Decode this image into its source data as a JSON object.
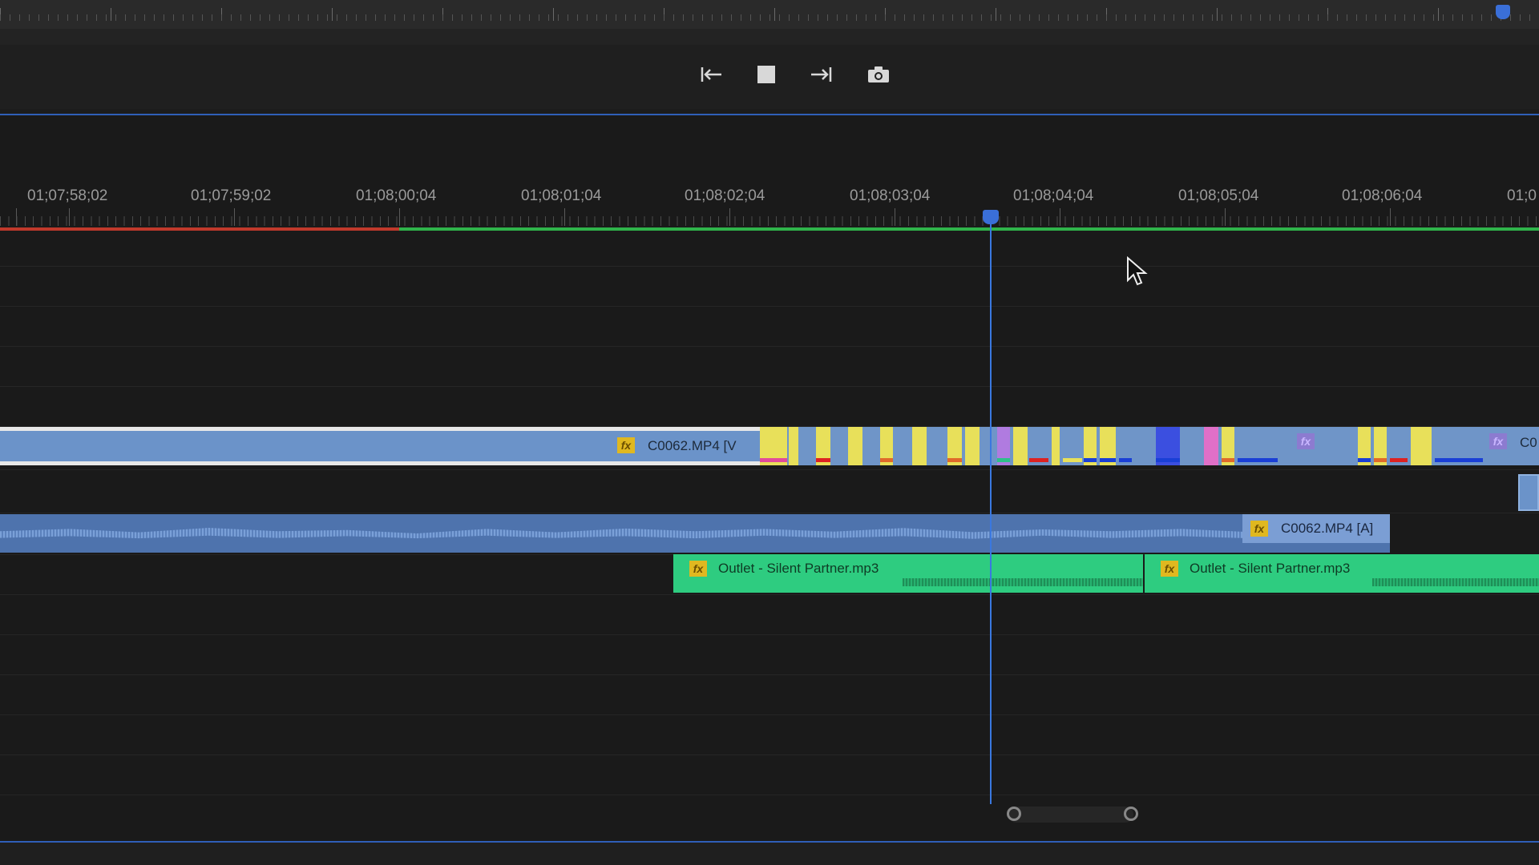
{
  "transport": {
    "go_to_in_icon": "{←",
    "stop_icon": "■",
    "go_to_out_icon": "→}",
    "export_frame_icon": "📷"
  },
  "ruler": {
    "timecodes": [
      "01;07;58;02",
      "01;07;59;02",
      "01;08;00;04",
      "01;08;01;04",
      "01;08;02;04",
      "01;08;03;04",
      "01;08;04;04",
      "01;08;05;04",
      "01;08;06;04",
      "01;0"
    ]
  },
  "tracks": {
    "video_clip_label": "C0062.MP4 [V",
    "video_clip_label_2": "C0",
    "audio_clip_label": "C0062.MP4 [A]",
    "music_clip_1_label": "Outlet - Silent Partner.mp3",
    "music_clip_2_label": "Outlet - Silent Partner.mp3",
    "fx_label": "fx"
  },
  "colors": {
    "playhead": "#3a78e0",
    "render_red": "#c0392b",
    "render_green": "#2fb34a",
    "video_clip": "#6b93c9",
    "music_clip": "#2ecc80"
  }
}
